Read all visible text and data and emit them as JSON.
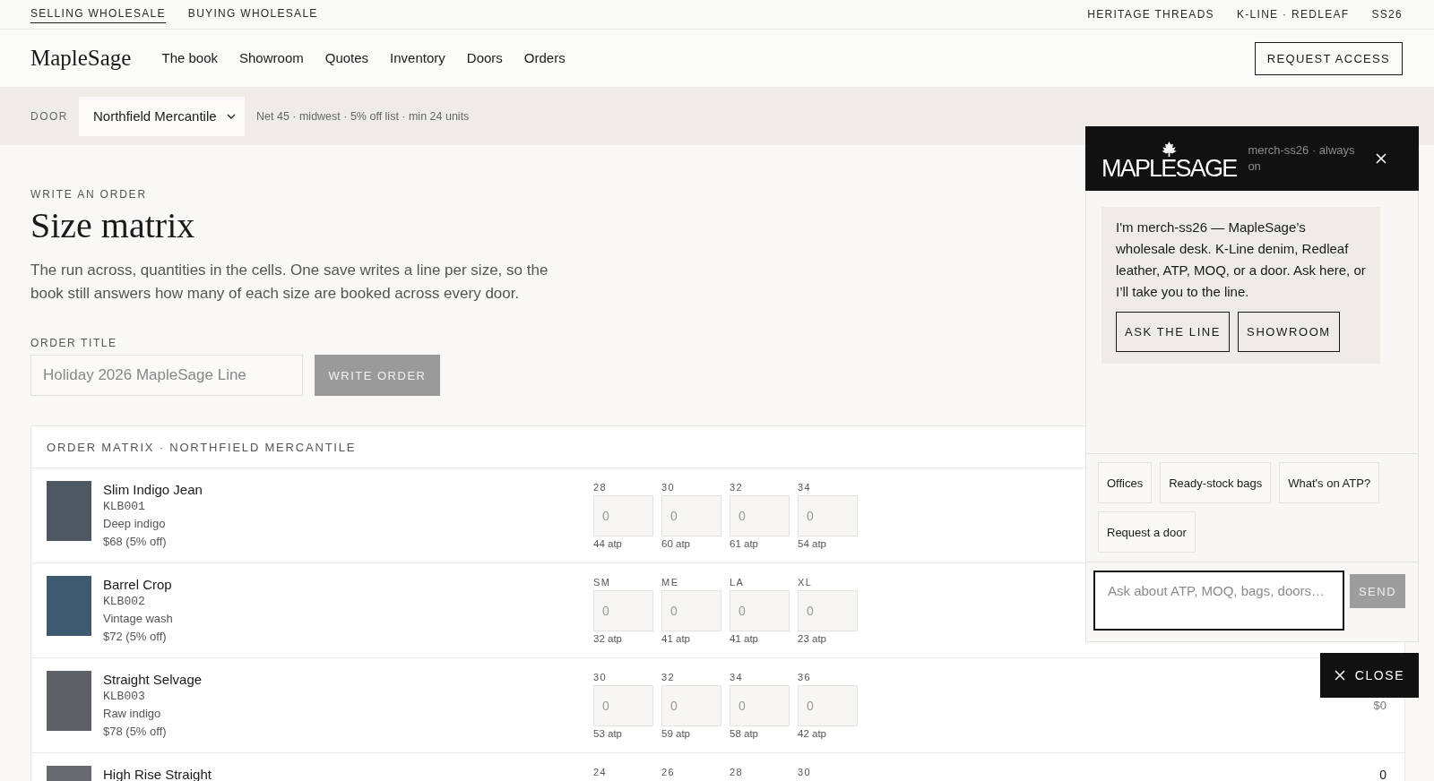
{
  "top_bar": {
    "left_links": [
      {
        "label": "SELLING WHOLESALE",
        "selected": true
      },
      {
        "label": "BUYING WHOLESALE",
        "selected": false
      }
    ],
    "right_items": [
      "HERITAGE THREADS",
      "K-LINE · REDLEAF",
      "SS26"
    ]
  },
  "nav": {
    "logo": "MapleSage",
    "links": [
      "The book",
      "Showroom",
      "Quotes",
      "Inventory",
      "Doors",
      "Orders"
    ],
    "cta": "REQUEST ACCESS"
  },
  "door_bar": {
    "label": "DOOR",
    "select_value": "Northfield Mercantile",
    "terms": "Net 45 · midwest · 5% off list · min 24 units"
  },
  "order": {
    "eyebrow": "WRITE AN ORDER",
    "title": "Size matrix",
    "intro": "The run across, quantities in the cells. One save writes a line per size, so the book still answers how many of each size are booked across every door.",
    "title_field": {
      "label": "ORDER TITLE",
      "placeholder": "Holiday 2026 MapleSage Line"
    },
    "submit": {
      "label": "WRITE ORDER",
      "disabled": true
    }
  },
  "matrix": {
    "header": "ORDER MATRIX · NORTHFIELD MERCANTILE",
    "rows": [
      {
        "name": "Slim Indigo Jean",
        "sku": "KLB001",
        "wash": "Deep indigo",
        "price": "$68 (5% off)",
        "sizes": [
          {
            "size": "28",
            "placeholder": "0",
            "atp": "44 atp"
          },
          {
            "size": "30",
            "placeholder": "0",
            "atp": "60 atp"
          },
          {
            "size": "32",
            "placeholder": "0",
            "atp": "61 atp"
          },
          {
            "size": "34",
            "placeholder": "0",
            "atp": "54 atp"
          }
        ]
      },
      {
        "name": "Barrel Crop",
        "sku": "KLB002",
        "wash": "Vintage wash",
        "price": "$72 (5% off)",
        "sizes": [
          {
            "size": "SM",
            "placeholder": "0",
            "atp": "32 atp"
          },
          {
            "size": "ME",
            "placeholder": "0",
            "atp": "41 atp"
          },
          {
            "size": "LA",
            "placeholder": "0",
            "atp": "41 atp"
          },
          {
            "size": "XL",
            "placeholder": "0",
            "atp": "23 atp"
          }
        ]
      },
      {
        "name": "Straight Selvage",
        "sku": "KLB003",
        "wash": "Raw indigo",
        "price": "$78 (5% off)",
        "sizes": [
          {
            "size": "30",
            "placeholder": "0",
            "atp": "53 atp"
          },
          {
            "size": "32",
            "placeholder": "0",
            "atp": "59 atp"
          },
          {
            "size": "34",
            "placeholder": "0",
            "atp": "58 atp"
          },
          {
            "size": "36",
            "placeholder": "0",
            "atp": "42 atp"
          }
        ],
        "total_amount": "$0"
      },
      {
        "name": "High Rise Straight",
        "sizes": [
          {
            "size": "24"
          },
          {
            "size": "26"
          },
          {
            "size": "28"
          },
          {
            "size": "30"
          }
        ],
        "total_units": "0"
      }
    ]
  },
  "chat": {
    "logo": "MAPLESAGE",
    "status": "merch-ss26 · always on",
    "message": "I'm merch-ss26 — MapleSage’s wholesale desk. K-Line denim, Redleaf leather, ATP, MOQ, or a door. Ask here, or I’ll take you to the line.",
    "message_actions": [
      "ASK THE LINE",
      "SHOWROOM"
    ],
    "suggestions": [
      "Offices",
      "Ready-stock bags",
      "What's on ATP?",
      "Request a door"
    ],
    "input": {
      "placeholder": "Ask about ATP, MOQ, bags, doors…"
    },
    "send": {
      "label": "SEND",
      "disabled": true
    }
  },
  "close_button": {
    "label": "CLOSE"
  }
}
